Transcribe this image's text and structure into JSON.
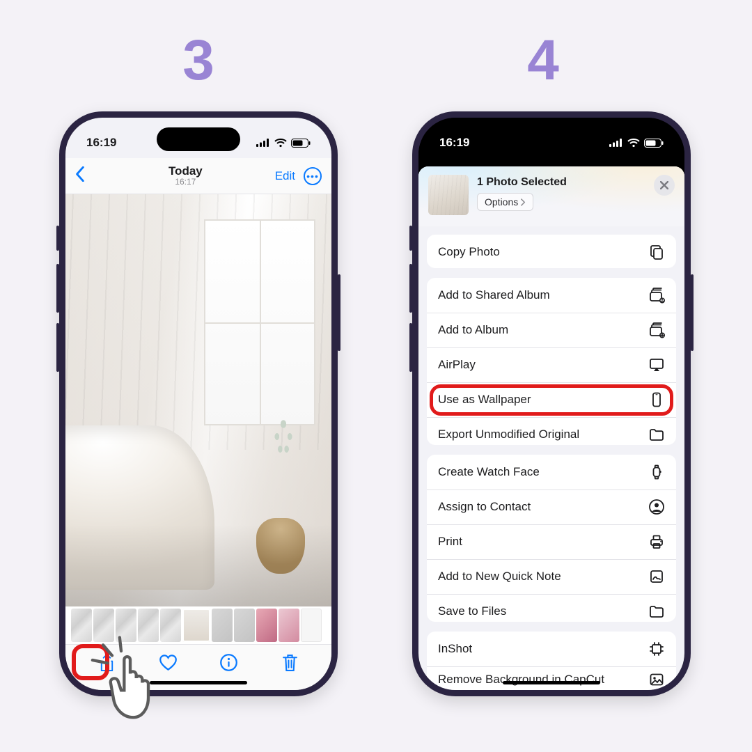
{
  "steps": {
    "s3": "3",
    "s4": "4"
  },
  "status": {
    "time": "16:19"
  },
  "nav": {
    "title": "Today",
    "subtitle": "16:17",
    "edit": "Edit"
  },
  "share": {
    "header_title": "1 Photo Selected",
    "options": "Options",
    "groups": [
      {
        "rows": [
          {
            "label": "Copy Photo",
            "icon": "copy",
            "hl": false
          }
        ]
      },
      {
        "rows": [
          {
            "label": "Add to Shared Album",
            "icon": "shared-album",
            "hl": false
          },
          {
            "label": "Add to Album",
            "icon": "add-album",
            "hl": false
          },
          {
            "label": "AirPlay",
            "icon": "airplay",
            "hl": false
          },
          {
            "label": "Use as Wallpaper",
            "icon": "wallpaper",
            "hl": true
          },
          {
            "label": "Export Unmodified Original",
            "icon": "folder",
            "hl": false
          }
        ]
      },
      {
        "rows": [
          {
            "label": "Create Watch Face",
            "icon": "watch",
            "hl": false
          },
          {
            "label": "Assign to Contact",
            "icon": "contact",
            "hl": false
          },
          {
            "label": "Print",
            "icon": "print",
            "hl": false
          },
          {
            "label": "Add to New Quick Note",
            "icon": "quicknote",
            "hl": false
          },
          {
            "label": "Save to Files",
            "icon": "folder",
            "hl": false
          }
        ]
      },
      {
        "rows": [
          {
            "label": "InShot",
            "icon": "inshot",
            "hl": false
          },
          {
            "label": "Remove Background in CapCut",
            "icon": "image",
            "hl": false,
            "cut": true
          }
        ]
      }
    ]
  }
}
